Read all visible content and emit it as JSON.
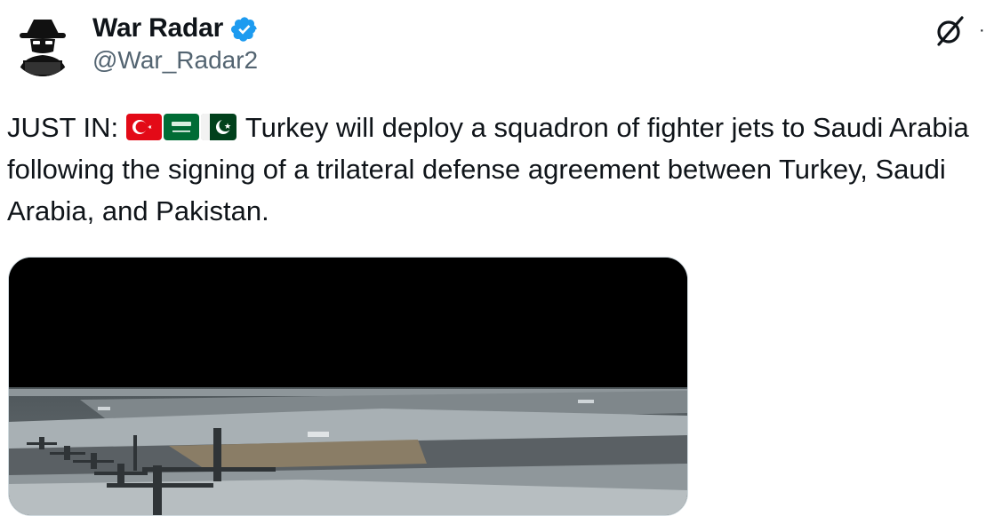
{
  "author": {
    "display_name": "War Radar",
    "handle": "@War_Radar2",
    "verified": true,
    "avatar_icon": "hacker-avatar-icon",
    "verified_icon": "verified-badge-icon",
    "verified_color": "#1d9bf0"
  },
  "toolbar": {
    "grok_icon": "grok-icon"
  },
  "tweet": {
    "prefix": "JUST IN: ",
    "flags": [
      "turkey-flag-icon",
      "saudi-arabia-flag-icon",
      "pakistan-flag-icon"
    ],
    "body": " Turkey will deploy a squadron of fighter jets to Saudi Arabia following the signing of a trilateral defense agreement between Turkey, Saudi Arabia, and Pakistan."
  },
  "media": {
    "kind": "video-thumbnail",
    "subject": "military-aircraft-on-runway"
  },
  "colors": {
    "text": "#0f1419",
    "secondary": "#536471",
    "border": "#cfd9de"
  }
}
